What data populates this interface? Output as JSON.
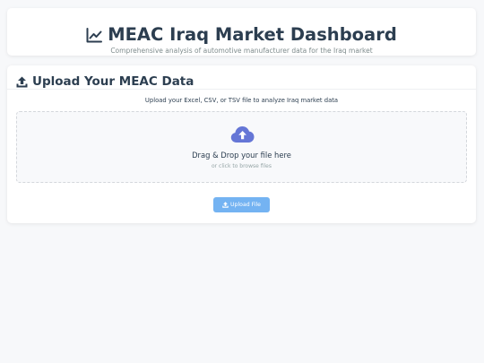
{
  "header": {
    "title": "MEAC Iraq Market Dashboard",
    "subtitle": "Comprehensive analysis of automotive manufacturer data for the Iraq market",
    "icon": "chart-line-icon"
  },
  "upload": {
    "title": "Upload Your MEAC Data",
    "title_icon": "upload-icon",
    "description": "Upload your Excel, CSV, or TSV file to analyze Iraq market data",
    "dropzone": {
      "icon": "cloud-upload-icon",
      "main_text": "Drag & Drop your file here",
      "sub_text": "or click to browse files"
    },
    "button_label": "Upload File",
    "button_icon": "upload-icon"
  },
  "colors": {
    "background": "#f7f8fa",
    "heading": "#2c3e50",
    "accent_cloud": "#6576d6",
    "button": "#74b3f2"
  }
}
